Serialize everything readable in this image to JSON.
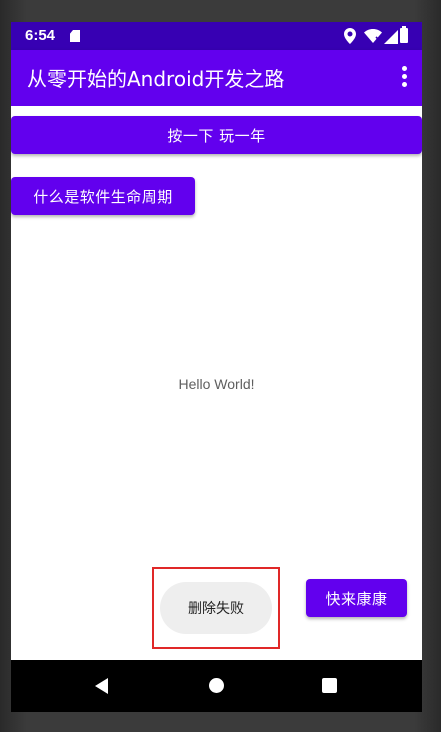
{
  "status_bar": {
    "time": "6:54",
    "icons": [
      "sd-card-icon",
      "location-icon",
      "wifi-icon",
      "signal-icon",
      "battery-icon"
    ],
    "background": "#3700b3"
  },
  "app_bar": {
    "title": "从零开始的Android开发之路",
    "background": "#6200ee",
    "menu_icon": "overflow-menu-icon"
  },
  "main": {
    "play_button_label": "按一下 玩一年",
    "lifecycle_button_label": "什么是软件生命周期",
    "hello_text": "Hello World!",
    "delete_toast_text": "删除失败",
    "health_button_label": "快来康康",
    "accent": "#6200ee"
  },
  "nav_bar": {
    "back": "back-icon",
    "home": "home-icon",
    "recents": "recents-icon"
  }
}
